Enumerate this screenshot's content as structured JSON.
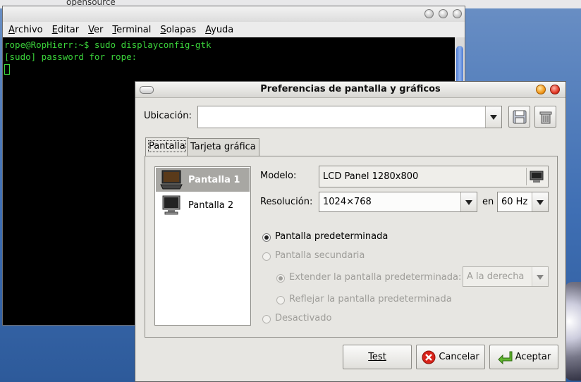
{
  "desktop": {
    "top_text": "opensource"
  },
  "terminal": {
    "menu": [
      "Archivo",
      "Editar",
      "Ver",
      "Terminal",
      "Solapas",
      "Ayuda"
    ],
    "lines": [
      "rope@RopHierr:~$ sudo displayconfig-gtk",
      "[sudo] password for rope:"
    ]
  },
  "dialog": {
    "title": "Preferencias de pantalla y gráficos",
    "location_label": "Ubicación:",
    "location_value": "",
    "tabs": [
      "Pantalla",
      "Tarjeta gráfica"
    ],
    "screens": [
      "Pantalla 1",
      "Pantalla 2"
    ],
    "model_label": "Modelo:",
    "model_value": "LCD Panel 1280x800",
    "resolution_label": "Resolución:",
    "resolution_value": "1024×768",
    "en_label": "en",
    "refresh_value": "60 Hz",
    "radio_primary": "Pantalla predeterminada",
    "radio_secondary": "Pantalla secundaria",
    "radio_extend": "Extender la pantalla predeterminada:",
    "extend_value": "A la derecha",
    "radio_mirror": "Reflejar la pantalla predeterminada",
    "radio_disabled": "Desactivado",
    "btn_test": "Test",
    "btn_cancel": "Cancelar",
    "btn_accept": "Aceptar"
  }
}
